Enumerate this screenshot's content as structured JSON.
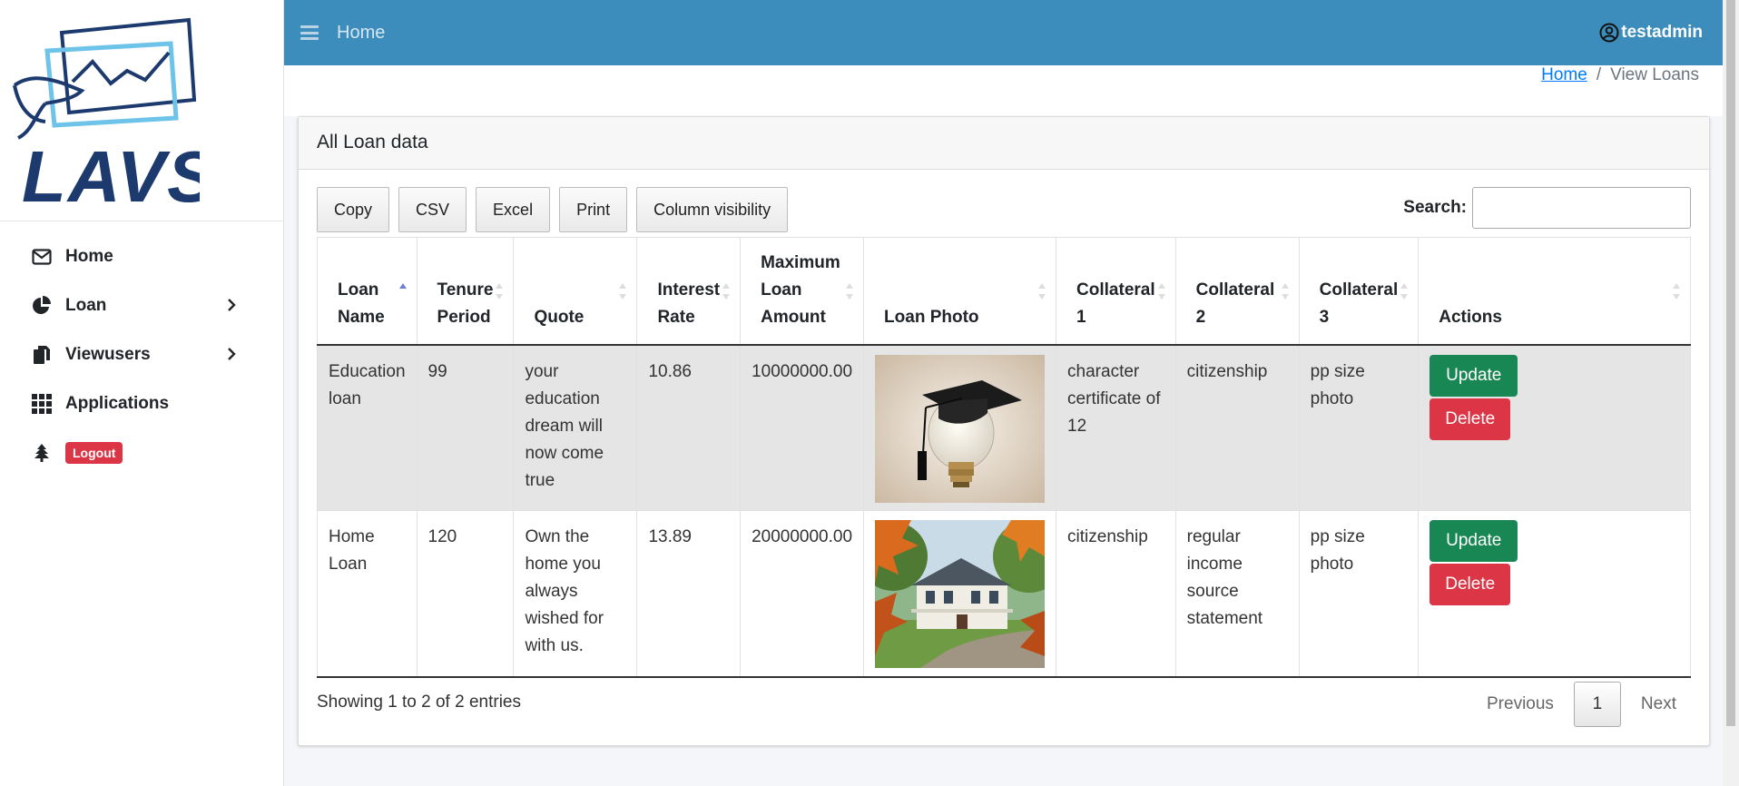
{
  "brand": {
    "logo_text": "LAVS"
  },
  "sidebar": {
    "items": [
      {
        "label": "Home",
        "icon": "envelope-icon"
      },
      {
        "label": "Loan",
        "icon": "pie-chart-icon"
      },
      {
        "label": "Viewusers",
        "icon": "files-icon"
      },
      {
        "label": "Applications",
        "icon": "grid-icon"
      }
    ],
    "logout_label": "Logout"
  },
  "topbar": {
    "home_label": "Home",
    "username": "testadmin"
  },
  "breadcrumb": {
    "home": "Home",
    "separator": "/",
    "current": "View Loans"
  },
  "card": {
    "title": "All Loan data"
  },
  "toolbar": {
    "buttons": [
      "Copy",
      "CSV",
      "Excel",
      "Print",
      "Column visibility"
    ]
  },
  "search": {
    "label": "Search:",
    "value": ""
  },
  "table": {
    "columns": [
      "Loan Name",
      "Tenure Period",
      "Quote",
      "Interest Rate",
      "Maximum Loan Amount",
      "Loan Photo",
      "Collateral 1",
      "Collateral 2",
      "Collateral 3",
      "Actions"
    ],
    "rows": [
      {
        "loan_name": "Education loan",
        "tenure": "99",
        "quote": "your education dream will now come true",
        "interest": "10.86",
        "max_amount": "10000000.00",
        "photo": "graduation-cap-bulb-photo",
        "collateral1": "character certificate of 12",
        "collateral2": "citizenship",
        "collateral3": "pp size photo"
      },
      {
        "loan_name": "Home Loan",
        "tenure": "120",
        "quote": "Own the home you always wished for with us.",
        "interest": "13.89",
        "max_amount": "20000000.00",
        "photo": "house-autumn-photo",
        "collateral1": "citizenship",
        "collateral2": "regular income source statement",
        "collateral3": "pp size photo"
      }
    ],
    "update_label": "Update",
    "delete_label": "Delete"
  },
  "footer": {
    "info": "Showing 1 to 2 of 2 entries",
    "previous": "Previous",
    "page": "1",
    "next": "Next"
  },
  "colors": {
    "header": "#3c8dbc",
    "update": "#198754",
    "delete": "#dc3545"
  }
}
